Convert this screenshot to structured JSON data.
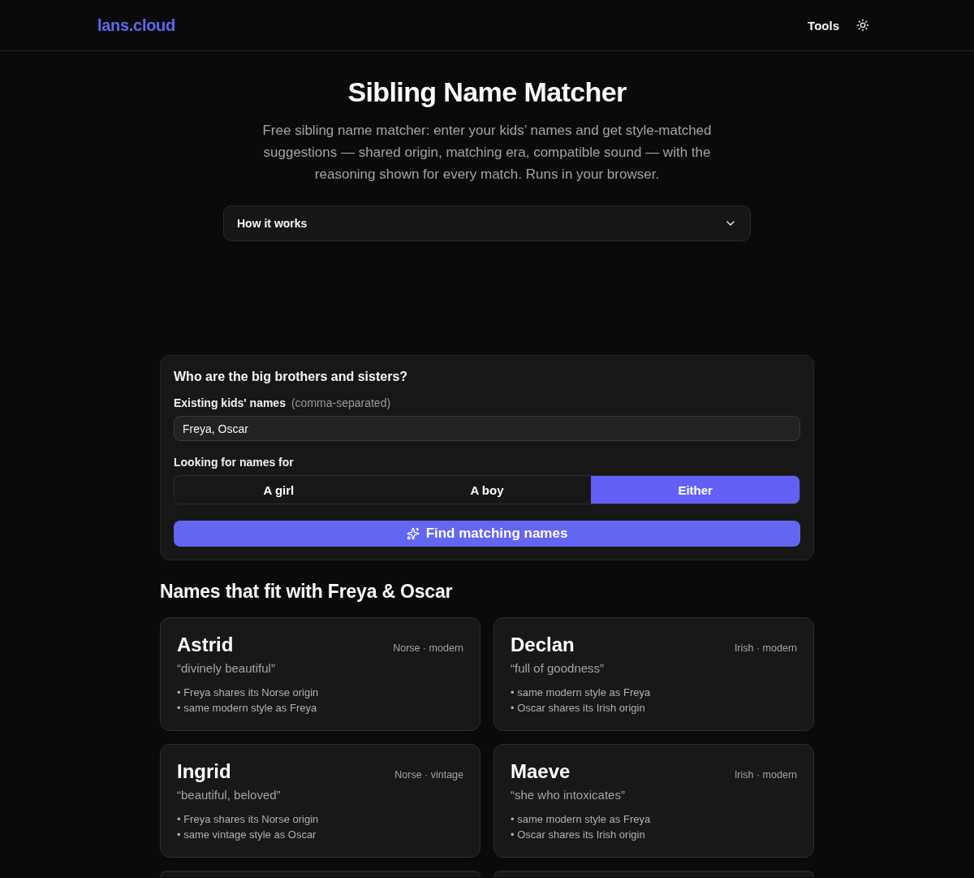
{
  "header": {
    "logo": "lans.cloud",
    "nav": [
      {
        "label": "Tools"
      }
    ]
  },
  "intro": {
    "title": "Sibling Name Matcher",
    "text": "Free sibling name matcher: enter your kids’ names and get style-matched suggestions — shared origin, matching era, compatible sound — with the reasoning shown for every match. Runs in your browser.",
    "accordion": {
      "label": "How it works",
      "expanded": false
    }
  },
  "form": {
    "heading": "Who are the big brothers and sisters?",
    "names_field": {
      "label": "Existing kids' names",
      "hint": "(comma-separated)",
      "value": "Freya, Oscar"
    },
    "gender": {
      "label": "Looking for names for",
      "options": [
        {
          "label": "A girl",
          "selected": false
        },
        {
          "label": "A boy",
          "selected": false
        },
        {
          "label": "Either",
          "selected": true
        }
      ]
    },
    "submit": "Find matching names"
  },
  "results": {
    "heading": "Names that fit with Freya & Oscar",
    "cards": [
      {
        "kind": "full",
        "name": "Astrid",
        "tags": "Norse · modern",
        "meaning": "“divinely beautiful”",
        "reasons": [
          "• Freya shares its Norse origin",
          "• same modern style as Freya"
        ]
      },
      {
        "kind": "full",
        "name": "Declan",
        "tags": "Irish · modern",
        "meaning": "“full of goodness”",
        "reasons": [
          "• same modern style as Freya",
          "• Oscar shares its Irish origin"
        ]
      },
      {
        "kind": "full",
        "name": "Ingrid",
        "tags": "Norse · vintage",
        "meaning": "“beautiful, beloved”",
        "reasons": [
          "• Freya shares its Norse origin",
          "• same vintage style as Oscar"
        ]
      },
      {
        "kind": "full",
        "name": "Maeve",
        "tags": "Irish · modern",
        "meaning": "“she who intoxicates”",
        "reasons": [
          "• same modern style as Freya",
          "• Oscar shares its Irish origin"
        ]
      },
      {
        "kind": "cut"
      },
      {
        "kind": "cut"
      }
    ]
  }
}
